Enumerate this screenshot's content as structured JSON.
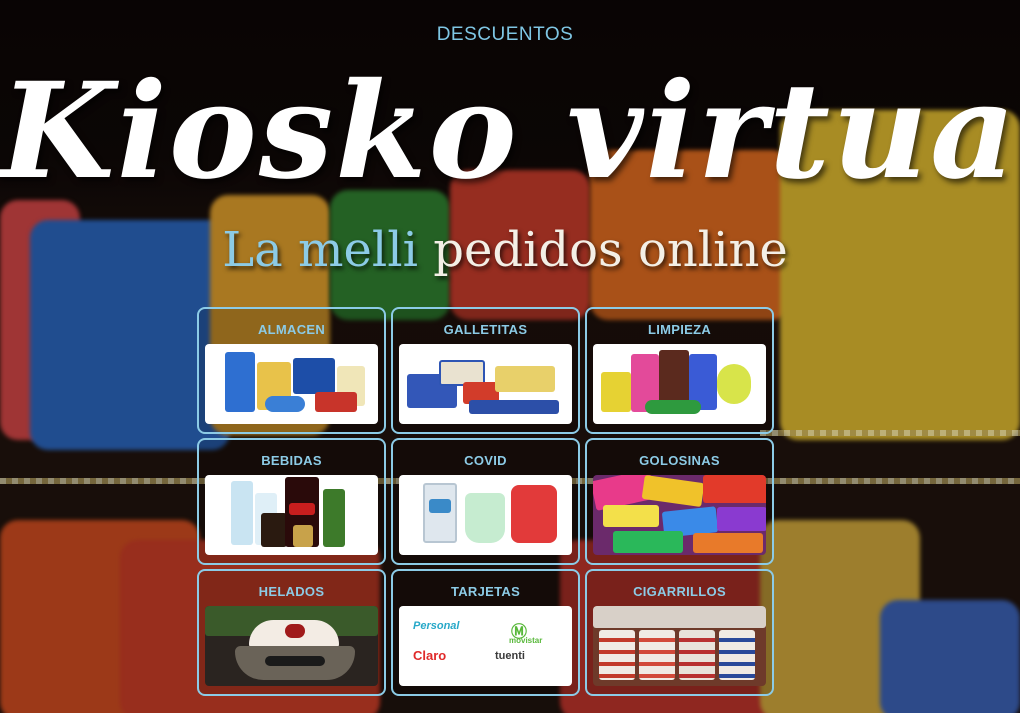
{
  "nav": {
    "discount_link": "DESCUENTOS"
  },
  "hero": {
    "title": "Kiosko virtual",
    "subtitle_brand": "La melli",
    "subtitle_rest": "pedidos online"
  },
  "categories": [
    {
      "label": "ALMACEN",
      "icon": "grocery-products-image"
    },
    {
      "label": "GALLETITAS",
      "icon": "cookies-image"
    },
    {
      "label": "LIMPIEZA",
      "icon": "cleaning-products-image"
    },
    {
      "label": "BEBIDAS",
      "icon": "drinks-image"
    },
    {
      "label": "COVID",
      "icon": "sanitizer-mask-image"
    },
    {
      "label": "GOLOSINAS",
      "icon": "candies-image"
    },
    {
      "label": "HELADOS",
      "icon": "ice-cream-image"
    },
    {
      "label": "TARJETAS",
      "icon": "phone-cards-image"
    },
    {
      "label": "CIGARRILLOS",
      "icon": "cigarettes-image"
    }
  ],
  "card_logos": {
    "personal": "Personal",
    "movistar": "movistar",
    "claro": "Claro",
    "tuenti": "tuenti"
  },
  "colors": {
    "accent": "#8ccbe6",
    "title": "#ffffff"
  }
}
